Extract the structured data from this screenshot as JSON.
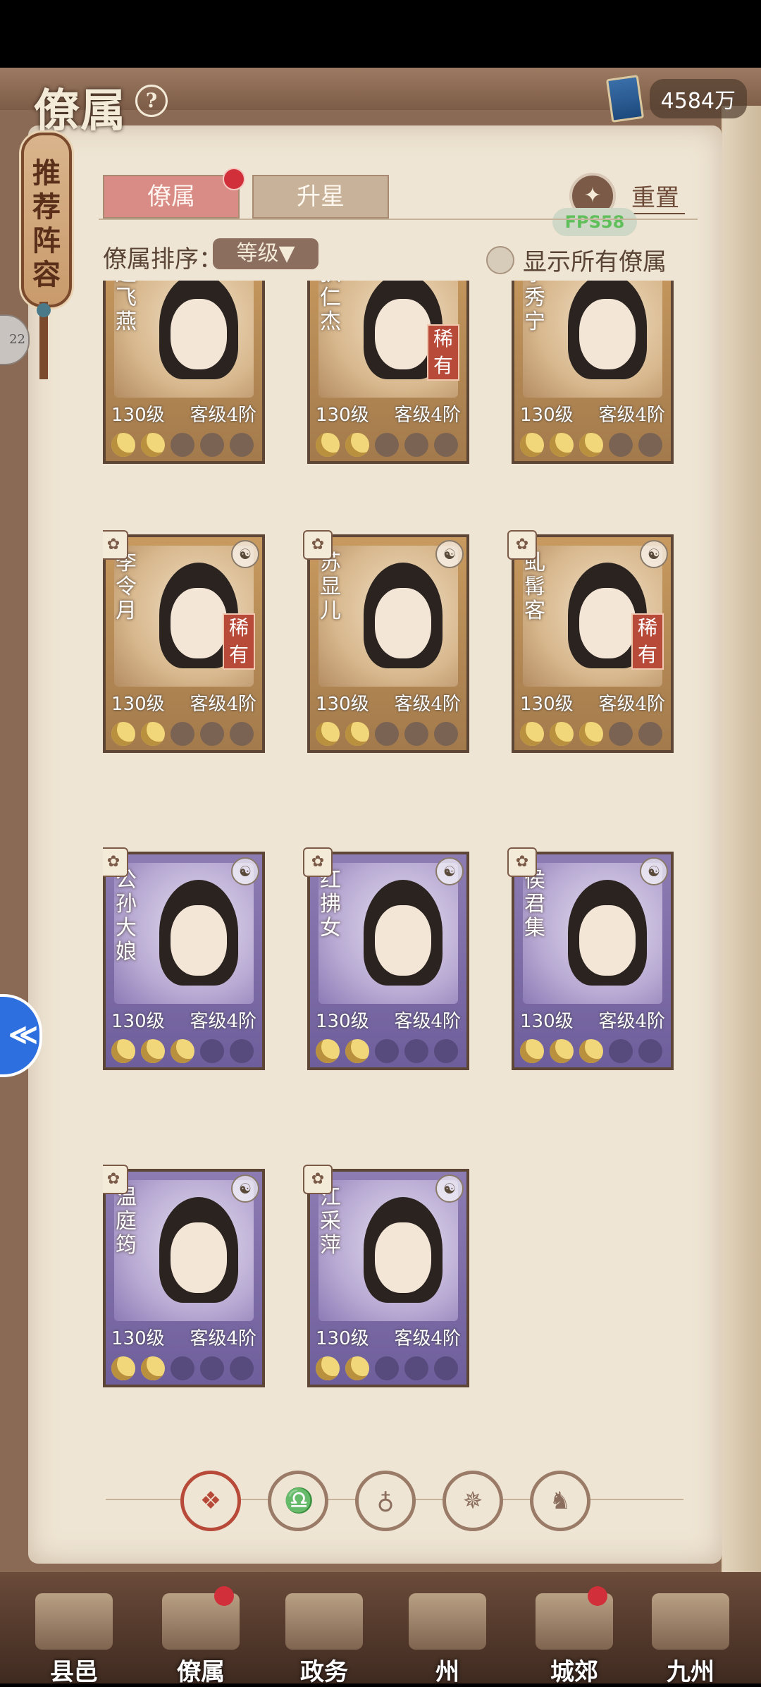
{
  "header": {
    "title": "僚属",
    "help_icon": "?",
    "currency_value": "4584万"
  },
  "recommend": {
    "label": "推荐阵容"
  },
  "side_badge": "22",
  "tabs": [
    {
      "label": "僚属",
      "active": true
    },
    {
      "label": "升星",
      "active": false
    }
  ],
  "reset": {
    "label": "重置"
  },
  "fps": "FPS58",
  "sort": {
    "label": "僚属排序：",
    "selected": "等级▼"
  },
  "show_all": {
    "label": "显示所有僚属"
  },
  "cards": [
    {
      "name": "赵飞燕",
      "level": "130级",
      "rank": "客级4阶",
      "rare": false,
      "moons_on": 2,
      "tier": "gold"
    },
    {
      "name": "狄仁杰",
      "level": "130级",
      "rank": "客级4阶",
      "rare": true,
      "moons_on": 2,
      "tier": "gold"
    },
    {
      "name": "李秀宁",
      "level": "130级",
      "rank": "客级4阶",
      "rare": false,
      "moons_on": 3,
      "tier": "gold"
    },
    {
      "name": "李令月",
      "level": "130级",
      "rank": "客级4阶",
      "rare": true,
      "moons_on": 2,
      "tier": "gold"
    },
    {
      "name": "苏显儿",
      "level": "130级",
      "rank": "客级4阶",
      "rare": false,
      "moons_on": 2,
      "tier": "gold"
    },
    {
      "name": "虬髯客",
      "level": "130级",
      "rank": "客级4阶",
      "rare": true,
      "moons_on": 3,
      "tier": "gold"
    },
    {
      "name": "公孙大娘",
      "level": "130级",
      "rank": "客级4阶",
      "rare": false,
      "moons_on": 3,
      "tier": "purple"
    },
    {
      "name": "红拂女",
      "level": "130级",
      "rank": "客级4阶",
      "rare": false,
      "moons_on": 2,
      "tier": "purple"
    },
    {
      "name": "侯君集",
      "level": "130级",
      "rank": "客级4阶",
      "rare": false,
      "moons_on": 3,
      "tier": "purple"
    },
    {
      "name": "温庭筠",
      "level": "130级",
      "rank": "客级4阶",
      "rare": false,
      "moons_on": 2,
      "tier": "purple"
    },
    {
      "name": "江采萍",
      "level": "130级",
      "rank": "客级4阶",
      "rare": false,
      "moons_on": 2,
      "tier": "purple"
    }
  ],
  "rare_label": "稀有",
  "filters": [
    "all-filter-icon",
    "bell-filter-icon",
    "gourd-filter-icon",
    "fan-filter-icon",
    "horse-filter-icon"
  ],
  "nav": [
    {
      "label": "县邑",
      "dot": false
    },
    {
      "label": "僚属",
      "dot": true
    },
    {
      "label": "政务",
      "dot": false
    },
    {
      "label": "州",
      "dot": false
    },
    {
      "label": "城郊",
      "dot": true
    },
    {
      "label": "九州",
      "dot": false
    }
  ]
}
